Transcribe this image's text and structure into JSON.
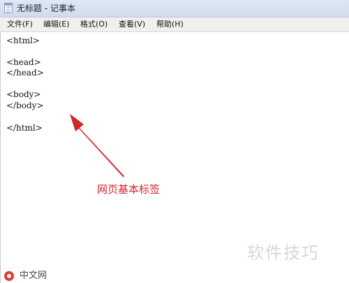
{
  "window": {
    "title": "无标题 - 记事本"
  },
  "menu": {
    "items": [
      {
        "label": "文件(F)"
      },
      {
        "label": "编辑(E)"
      },
      {
        "label": "格式(O)"
      },
      {
        "label": "查看(V)"
      },
      {
        "label": "帮助(H)"
      }
    ]
  },
  "editor": {
    "lines": [
      "<html>",
      "<head>",
      "</head>",
      "<body>",
      "</body>",
      "</html>"
    ]
  },
  "annotation": {
    "text": "网页基本标签",
    "color": "#d0262d"
  },
  "watermarks": {
    "right": "软件技巧",
    "left": "中文网"
  },
  "icons": {
    "app": "notepad-icon",
    "logo": "php-logo-icon"
  }
}
